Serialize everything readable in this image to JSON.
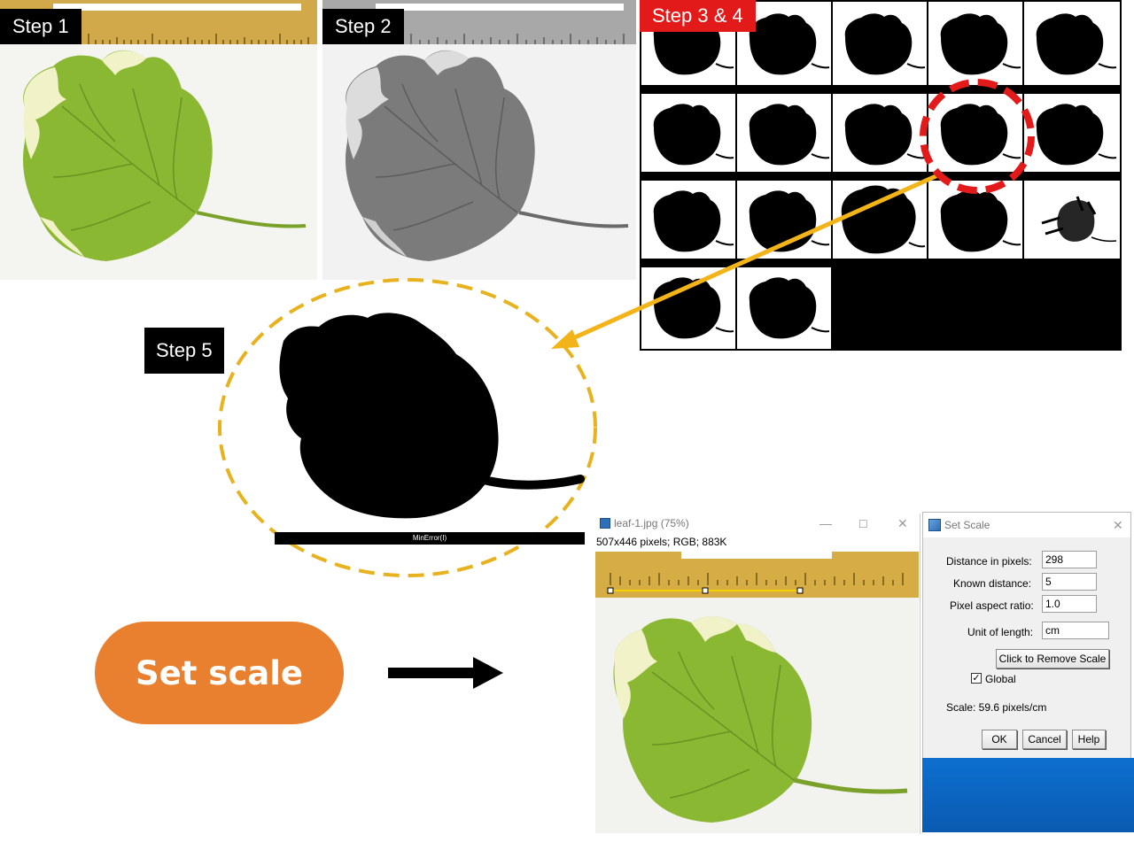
{
  "steps": {
    "step1": "Step 1",
    "step2": "Step 2",
    "step34": "Step 3 & 4",
    "step5": "Step 5"
  },
  "threshold_caption": "MinError(I)",
  "set_scale_label": "Set scale",
  "image_window": {
    "title": "leaf-1.jpg (75%)",
    "info": "507x446 pixels; RGB; 883K"
  },
  "dialog": {
    "title": "Set Scale",
    "distance_label": "Distance in pixels:",
    "distance_value": "298",
    "known_label": "Known distance:",
    "known_value": "5",
    "aspect_label": "Pixel aspect ratio:",
    "aspect_value": "1.0",
    "unit_label": "Unit of length:",
    "unit_value": "cm",
    "remove_button": "Click to Remove Scale",
    "global_label": "Global",
    "global_checked": true,
    "scale_text": "Scale: 59.6 pixels/cm",
    "ok_button": "OK",
    "cancel_button": "Cancel",
    "help_button": "Help"
  },
  "colors": {
    "leaf_green": "#8bb832",
    "leaf_cream": "#f2f2c8",
    "pill_orange": "#e9802f",
    "arrow_yellow": "#f2b418",
    "dash_yellow": "#e8b21e",
    "highlight_red": "#e31a1a",
    "ruler_gold": "#d2a94a"
  }
}
